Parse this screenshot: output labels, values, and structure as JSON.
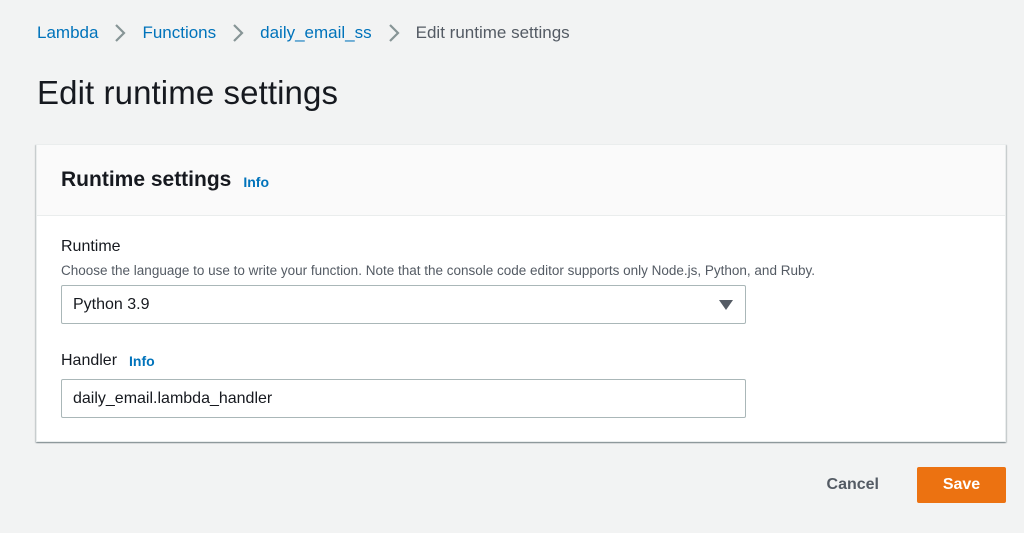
{
  "breadcrumb": {
    "items": [
      {
        "label": "Lambda"
      },
      {
        "label": "Functions"
      },
      {
        "label": "daily_email_ss"
      }
    ],
    "current": "Edit runtime settings"
  },
  "page": {
    "title": "Edit runtime settings"
  },
  "panel": {
    "title": "Runtime settings",
    "info_label": "Info",
    "runtime": {
      "label": "Runtime",
      "description": "Choose the language to use to write your function. Note that the console code editor supports only Node.js, Python, and Ruby.",
      "selected_value": "Python 3.9"
    },
    "handler": {
      "label": "Handler",
      "info_label": "Info",
      "value": "daily_email.lambda_handler"
    }
  },
  "actions": {
    "cancel_label": "Cancel",
    "save_label": "Save"
  },
  "icons": {
    "separator": "chevron-right-icon",
    "select_caret": "caret-down-icon"
  },
  "colors": {
    "link": "#0073bb",
    "primary_button": "#ec7211",
    "background": "#f2f3f3",
    "panel_header": "#fafafa"
  }
}
